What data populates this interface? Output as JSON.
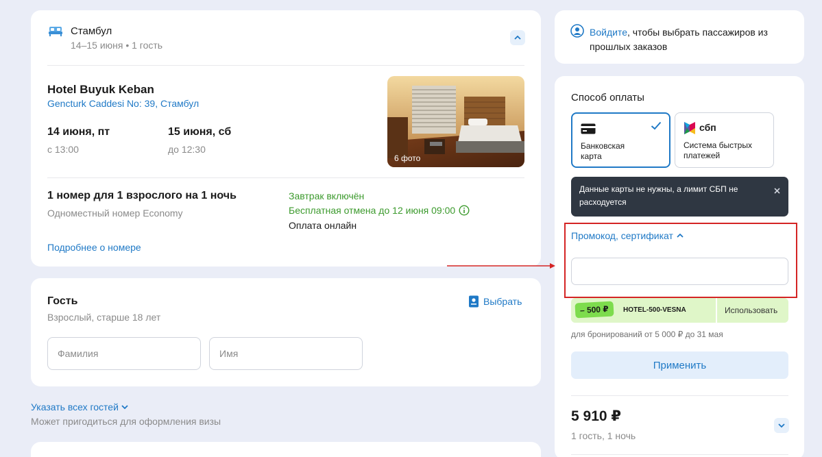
{
  "hotel": {
    "city": "Стамбул",
    "dates_guests": "14–15 июня • 1 гость",
    "name": "Hotel Buyuk Keban",
    "address": "Gencturk Caddesi No: 39, Стамбул",
    "checkin_date": "14 июня, пт",
    "checkin_time": "с 13:00",
    "checkout_date": "15 июня, сб",
    "checkout_time": "до 12:30",
    "photo_count": "6 фото",
    "room_title": "1 номер для 1 взрослого на 1 ночь",
    "room_type": "Одноместный номер Economy",
    "breakfast": "Завтрак включён",
    "cancellation": "Бесплатная отмена до 12 июня 09:00",
    "payment": "Оплата онлайн",
    "room_details_link": "Подробнее о номере"
  },
  "guest": {
    "title": "Гость",
    "subtitle": "Взрослый, старше 18 лет",
    "choose_label": "Выбрать",
    "last_name_placeholder": "Фамилия",
    "first_name_placeholder": "Имя"
  },
  "all_guests": {
    "link": "Указать всех гостей",
    "hint": "Может пригодиться для оформления визы"
  },
  "login": {
    "link": "Войдите",
    "text": ", чтобы выбрать пассажиров из прошлых заказов"
  },
  "payment": {
    "title": "Способ оплаты",
    "card_label": "Банковская карта",
    "sbp_logo_text": "сбп",
    "sbp_label": "Система быстрых платежей",
    "tooltip": "Данные карты не нужны, а лимит СБП не расходуется",
    "promo_link": "Промокод, сертификат",
    "coupon_badge": "– 500 ₽",
    "coupon_code": "HOTEL-500-VESNA",
    "coupon_use": "Использовать",
    "coupon_note": "для бронирований от 5 000 ₽ до 31 мая",
    "apply_label": "Применить",
    "price": "5 910 ₽",
    "price_note": "1 гость, 1 ночь"
  },
  "colors": {
    "accent": "#1f79c6",
    "green": "#3c9a2d",
    "highlight": "#d42424"
  }
}
